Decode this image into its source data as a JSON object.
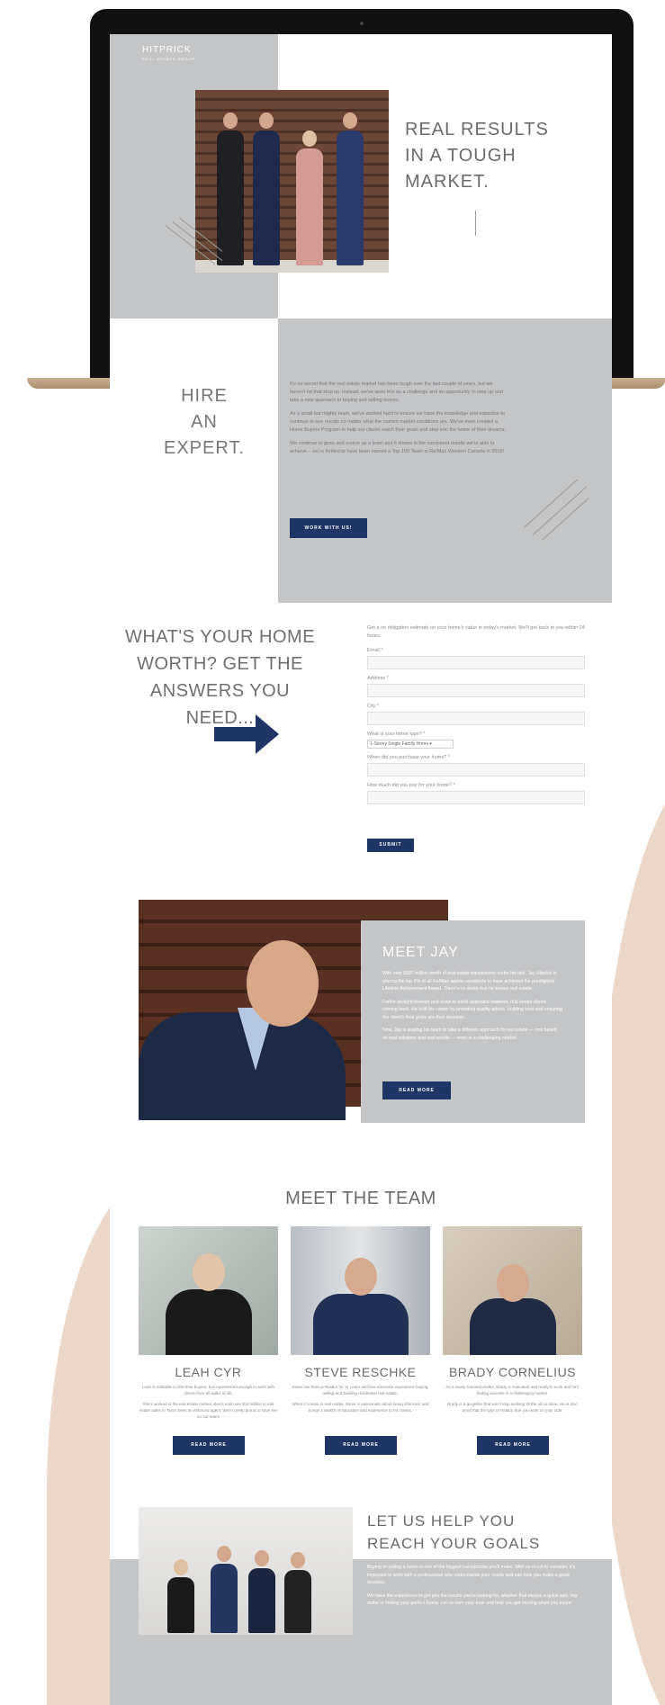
{
  "brand": {
    "logo": "HITPRICK",
    "logo_sub": "REAL ESTATE GROUP",
    "accent": "#1f3566",
    "panel": "#c4c5c7",
    "blob": "#ecd8cb"
  },
  "hero": {
    "title": "REAL RESULTS\nIN A TOUGH\nMARKET."
  },
  "hire": {
    "title": "HIRE\nAN\nEXPERT.",
    "paragraphs": [
      "It's no secret that the real estate market has been tough over the last couple of years, but we haven't let that stop us. Instead, we've seen this as a challenge and an opportunity to step up and take a new approach to buying and selling homes.",
      "As a small but mighty team, we've worked hard to ensure we have the knowledge and expertise to continue to see results no matter what the current market conditions are. We've even created a Home Buyers Program to help our clients reach their goals and step into the home of their dreams.",
      "We continue to grow and evolve as a team and it shows in the consistent results we're able to achieve – we're thrilled to have been named a Top 100 Team in Re/Max Western Canada in 2019!"
    ],
    "button": "WORK WITH US!"
  },
  "worth": {
    "title": "WHAT'S YOUR HOME WORTH? GET THE ANSWERS YOU NEED...",
    "intro": "Get a no obligation estimate on your home's value in today's market. We'll get back to you within 24 hours.",
    "fields": {
      "email": "Email *",
      "address": "Address *",
      "city": "City *",
      "home_type": "What is your home type? *",
      "home_type_value": "1-Storey Single Family Home ▾",
      "purchase_when": "When did you purchase your home? *",
      "purchase_price": "How much did you pay for your home? *"
    },
    "submit": "SUBMIT"
  },
  "jay": {
    "title": "MEET JAY",
    "paragraphs": [
      "With over $187 million worth of real estate transactions under his belt, Jay Hitprick is among the top 6% of all Re/Max agents worldwide to have achieved the prestigious Lifetime Achievement Award. There's no doubt that he knows real estate.",
      "Forthe straight-forward and down to earth approach however, that keeps clients coming back. He built his career by providing quality advice, building trust and ensuring the client's final goals are their decision.",
      "Now, Jay is leading his team to take a different approach to real estate — one based on real solutions and real results — even in a challenging market."
    ],
    "button": "READ MORE"
  },
  "team": {
    "title": "MEET THE TEAM",
    "members": [
      {
        "name": "LEAH CYR",
        "text1": "Leah is relatable to first-time buyers, but experienced enough to work with clients from all walks of life.",
        "text2": "She's worked in the real estate market, Bea's sold over $16 Million in real estate sales in Two's been an enforced agent. We're pretty proud to have her on our team!",
        "button": "READ MORE"
      },
      {
        "name": "STEVE RESCHKE",
        "text1": "Steve has been a Realtor for 11 years and has extensive experience buying, selling and building residential real estate.",
        "text2": "When it comes to real estate, Steve is passionate about being informed, and brings a wealth of education and experience to his clients.",
        "button": "READ MORE"
      },
      {
        "name": "BRADY CORNELIUS",
        "text1": "As a newly licensed realtor, Brady is motivated and ready to work and he's finding success in a challenging market.",
        "text2": "Brady is a go-getter that won't stop working till the job is done. He is also proof that the type of Realtor that you want on your side.",
        "button": "READ MORE"
      }
    ]
  },
  "goals": {
    "title": "LET US HELP YOU\nREACH YOUR GOALS",
    "paragraphs": [
      "Buying or selling a home is one of the biggest transactions you'll make. With so much to consider, it's important to work with a professional who understands your needs and can help you make a good decision.",
      "We have the experience to get you the results you're looking for, whether that means a quick sale, top dollar or finding your perfect home. Let us earn your trust and help you get moving when you move!"
    ]
  }
}
